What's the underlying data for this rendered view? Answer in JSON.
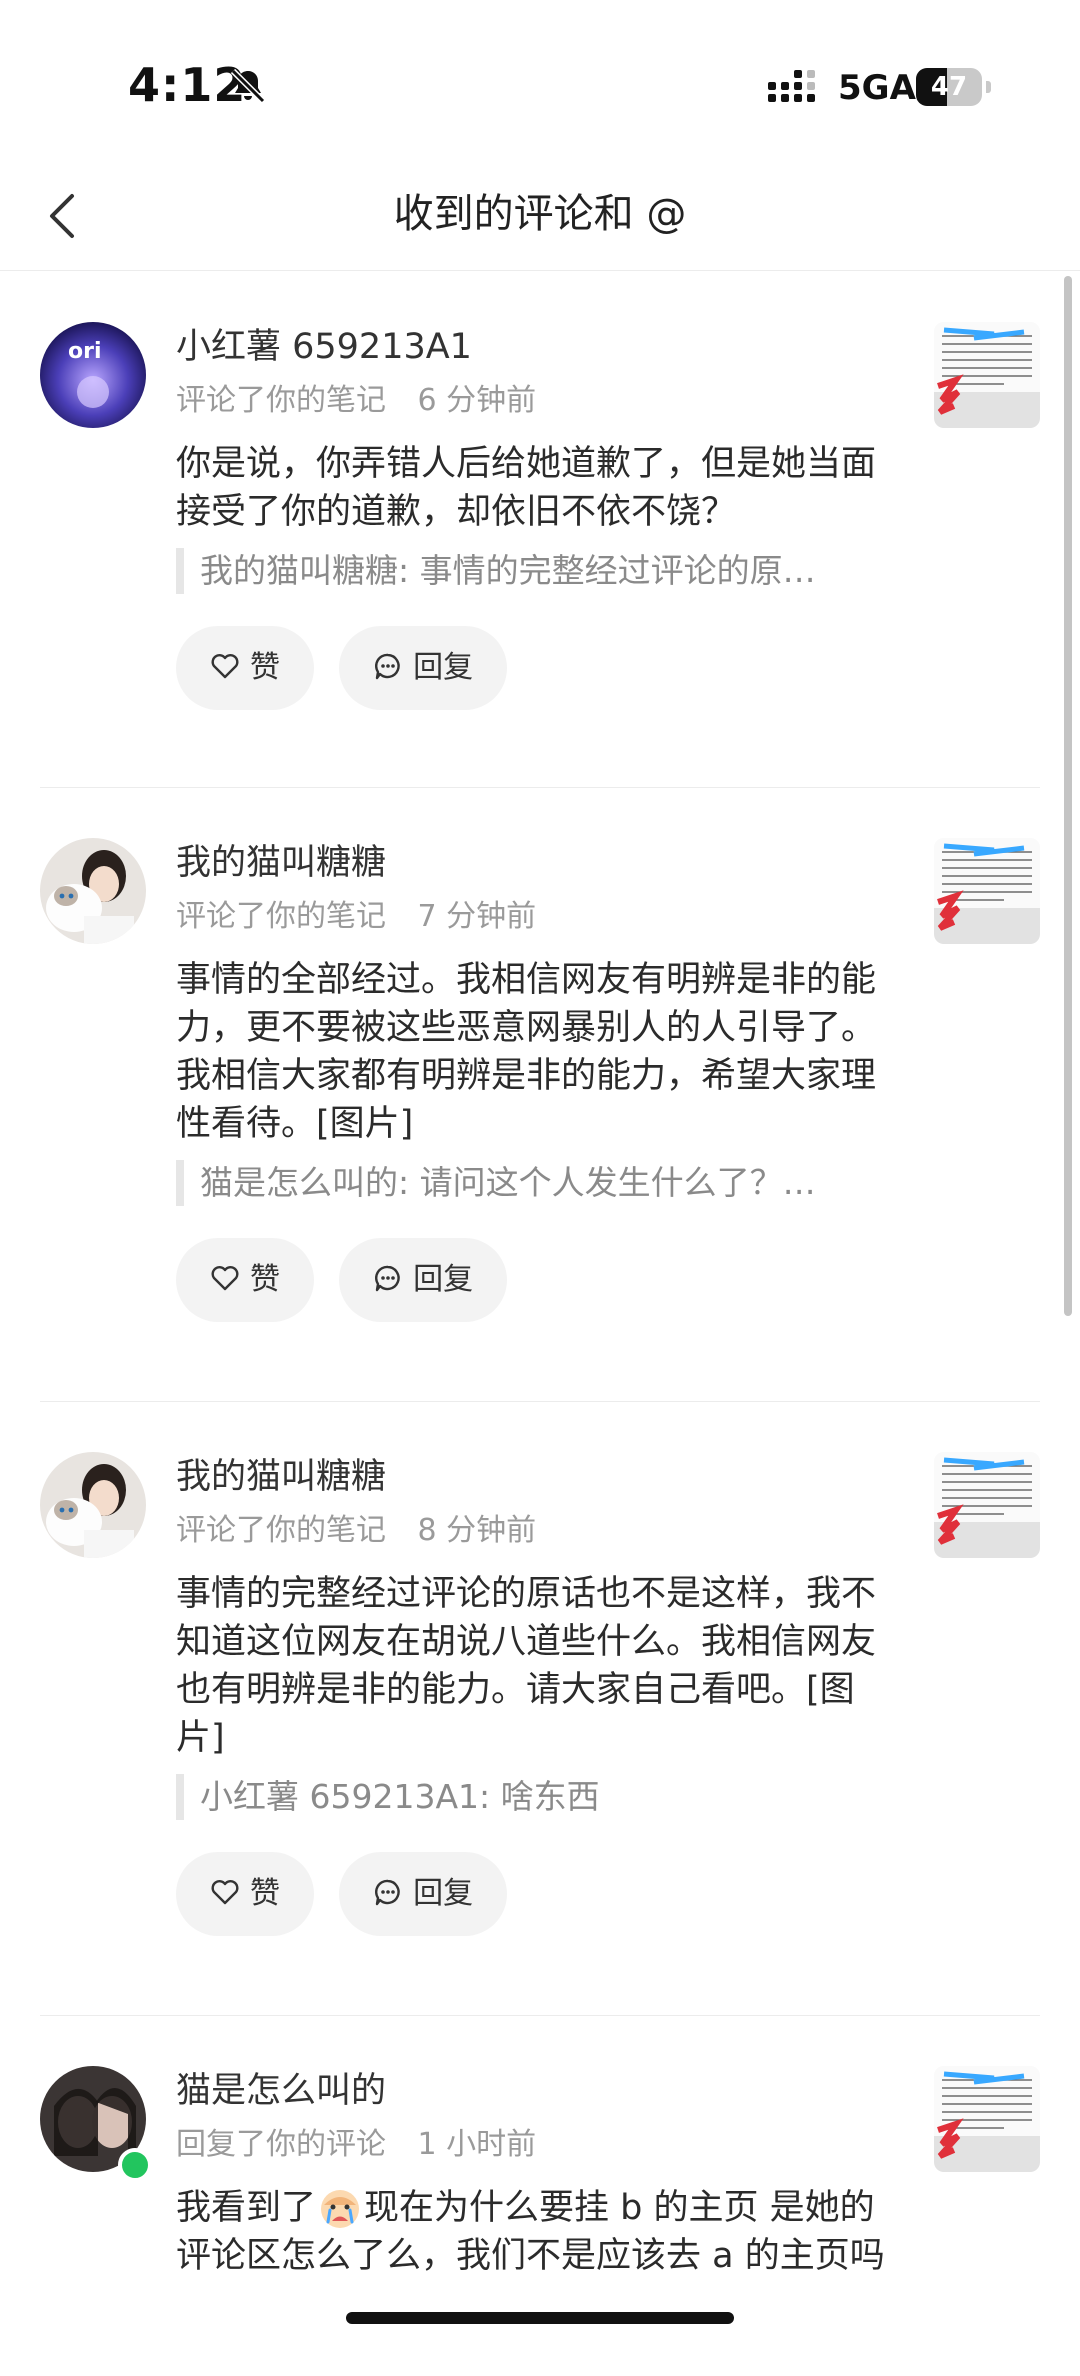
{
  "status_bar": {
    "time": "4:12",
    "network": "5GA",
    "battery": "47",
    "battery_level": 0.47
  },
  "header": {
    "title": "收到的评论和 @"
  },
  "actions": {
    "like_label": "赞",
    "reply_label": "回复"
  },
  "items": [
    {
      "username": "小红薯 659213A1",
      "action": "评论了你的笔记",
      "time": "6 分钟前",
      "text": "你是说，你弄错人后给她道歉了，但是她当面接受了你的道歉，却依旧不依不饶？",
      "quote": "我的猫叫糖糖: 事情的完整经过评论的原…"
    },
    {
      "username": "我的猫叫糖糖",
      "action": "评论了你的笔记",
      "time": "7 分钟前",
      "text": "事情的全部经过。我相信网友有明辨是非的能力，更不要被这些恶意网暴别人的人引导了。我相信大家都有明辨是非的能力，希望大家理性看待。[图片]",
      "quote": "猫是怎么叫的: 请问这个人发生什么了？…"
    },
    {
      "username": "我的猫叫糖糖",
      "action": "评论了你的笔记",
      "time": "8 分钟前",
      "text": "事情的完整经过评论的原话也不是这样，我不知道这位网友在胡说八道些什么。我相信网友也有明辨是非的能力。请大家自己看吧。[图片]",
      "quote": "小红薯 659213A1: 啥东西"
    },
    {
      "username": "猫是怎么叫的",
      "action": "回复了你的评论",
      "time": "1 小时前",
      "text_before_emoji": "我看到了",
      "text_after_emoji": "现在为什么要挂 b 的主页 是她的评论区怎么了么，我们不是应该去 a 的主页吗",
      "emoji": "crying-face-emoji"
    }
  ],
  "icons": {
    "back": "back-arrow-icon",
    "bell": "bell-slash-icon",
    "like": "heart-icon",
    "reply": "chat-bubble-icon"
  },
  "colors": {
    "online": "#22c55e",
    "button_bg": "#f3f3f3",
    "meta_text": "#9a9a9a"
  }
}
